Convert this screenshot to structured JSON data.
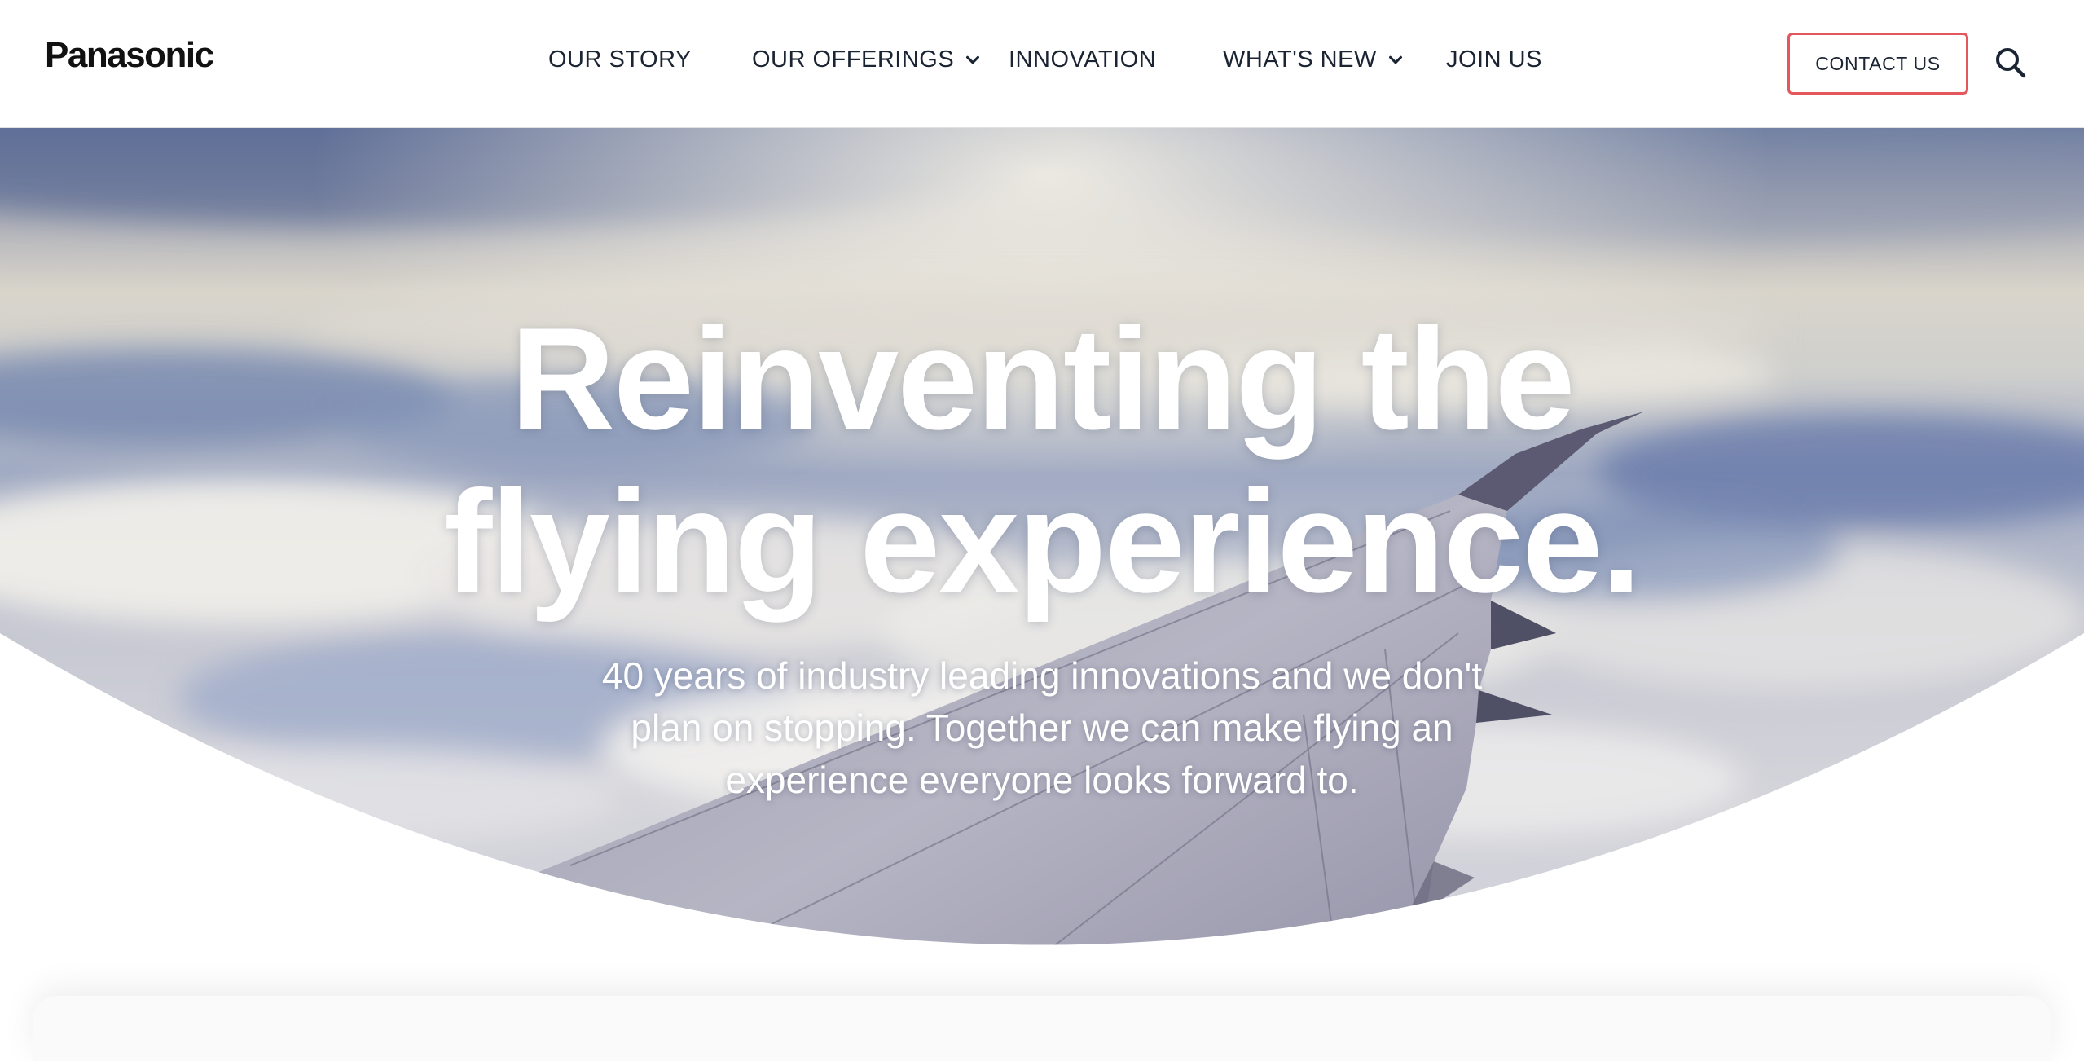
{
  "brand": {
    "logo_text": "Panasonic"
  },
  "nav": {
    "items": [
      {
        "label": "OUR STORY",
        "has_dropdown": false
      },
      {
        "label": "OUR OFFERINGS",
        "has_dropdown": true
      },
      {
        "label": "INNOVATION",
        "has_dropdown": false
      },
      {
        "label": "WHAT'S NEW",
        "has_dropdown": true
      },
      {
        "label": "JOIN US",
        "has_dropdown": false
      }
    ],
    "contact_label": "CONTACT US",
    "search_icon": "search-icon",
    "chevron_icon": "chevron-down-icon"
  },
  "hero": {
    "title_line1": "Reinventing the",
    "title_line2": "flying experience.",
    "subtitle": "40 years of industry leading innovations and we don't plan on stopping. Together we can make flying an experience everyone looks forward to.",
    "background": "airplane-wing-above-clouds"
  },
  "colors": {
    "accent": "#e4575d",
    "nav_text": "#1b2433",
    "hero_text": "#ffffff",
    "sky_top": "#6f7ea3",
    "cloud_light": "#e8e6e1"
  }
}
